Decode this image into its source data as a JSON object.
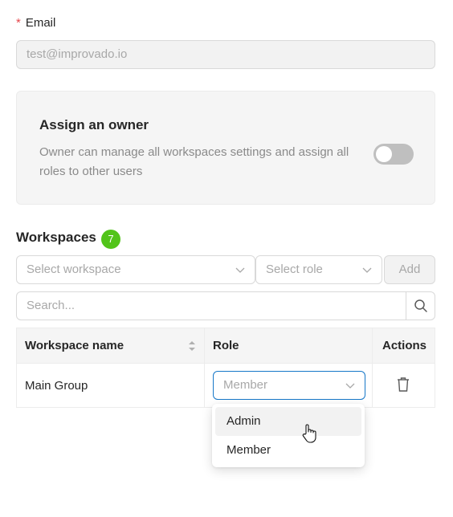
{
  "email": {
    "required_mark": "*",
    "label": "Email",
    "value": "test@improvado.io"
  },
  "owner": {
    "title": "Assign an owner",
    "description": "Owner can manage all workspaces settings and assign all roles to other users",
    "toggle_on": false
  },
  "workspaces": {
    "title": "Workspaces",
    "count": "7",
    "count_color": "#52c41a",
    "select_workspace_placeholder": "Select workspace",
    "select_role_placeholder": "Select role",
    "add_label": "Add",
    "search_placeholder": "Search..."
  },
  "table": {
    "columns": [
      "Workspace name",
      "Role",
      "Actions"
    ],
    "rows": [
      {
        "name": "Main Group",
        "role_placeholder": "Member"
      }
    ]
  },
  "role_dropdown": {
    "options": [
      "Admin",
      "Member"
    ],
    "hovered": "Admin"
  },
  "colors": {
    "accent": "#1677c8"
  }
}
